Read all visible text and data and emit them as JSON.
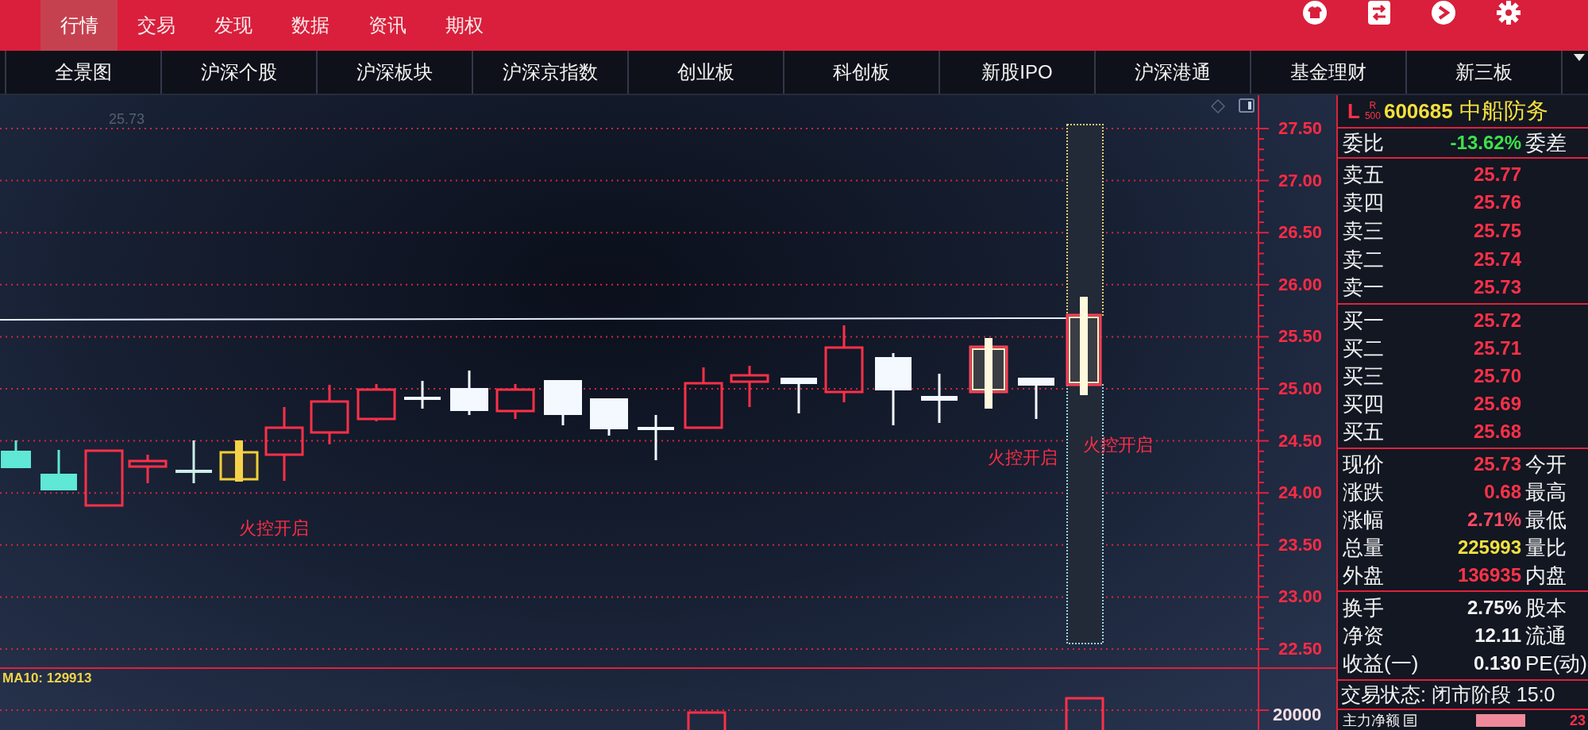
{
  "top_menu": [
    {
      "label": "行情",
      "selected": true
    },
    {
      "label": "交易",
      "selected": false
    },
    {
      "label": "发现",
      "selected": false
    },
    {
      "label": "数据",
      "selected": false
    },
    {
      "label": "资讯",
      "selected": false
    },
    {
      "label": "期权",
      "selected": false
    }
  ],
  "nav_tabs": [
    "全景图",
    "沪深个股",
    "沪深板块",
    "沪深京指数",
    "创业板",
    "科创板",
    "新股IPO",
    "沪深港通",
    "基金理财",
    "新三板"
  ],
  "chart": {
    "header_value": "25.73",
    "y_axis_labels": [
      "27.50",
      "27.00",
      "26.50",
      "26.00",
      "25.50",
      "25.00",
      "24.50",
      "24.00",
      "23.50",
      "23.00",
      "22.50"
    ],
    "annotations": [
      "火控开启",
      "火控开启",
      "火控开启"
    ],
    "indicator": "MA10: 129913",
    "volume_axis_label": "20000"
  },
  "quote_panel": {
    "market_tag": "L",
    "sub_tags": [
      "R",
      "500"
    ],
    "code": "600685",
    "name": "中船防务",
    "ratio": {
      "label": "委比",
      "value": "-13.62%",
      "right_label": "委差"
    },
    "asks": [
      {
        "label": "卖五",
        "price": "25.77"
      },
      {
        "label": "卖四",
        "price": "25.76"
      },
      {
        "label": "卖三",
        "price": "25.75"
      },
      {
        "label": "卖二",
        "price": "25.74"
      },
      {
        "label": "卖一",
        "price": "25.73"
      }
    ],
    "bids": [
      {
        "label": "买一",
        "price": "25.72"
      },
      {
        "label": "买二",
        "price": "25.71"
      },
      {
        "label": "买三",
        "price": "25.70"
      },
      {
        "label": "买四",
        "price": "25.69"
      },
      {
        "label": "买五",
        "price": "25.68"
      }
    ],
    "stats": [
      {
        "label": "现价",
        "value": "25.73",
        "right_label": "今开",
        "color": "#ff3348"
      },
      {
        "label": "涨跌",
        "value": "0.68",
        "right_label": "最高",
        "color": "#ff3348"
      },
      {
        "label": "涨幅",
        "value": "2.71%",
        "right_label": "最低",
        "color": "#ff4a60"
      },
      {
        "label": "总量",
        "value": "225993",
        "right_label": "量比",
        "color": "#f2e040"
      },
      {
        "label": "外盘",
        "value": "136935",
        "right_label": "内盘",
        "color": "#ff3348"
      }
    ],
    "fundamentals": [
      {
        "label": "换手",
        "value": "2.75%",
        "right_label": "股本"
      },
      {
        "label": "净资",
        "value": "12.11",
        "right_label": "流通"
      },
      {
        "label": "收益(一)",
        "value": "0.130",
        "right_label": "PE(动)"
      }
    ],
    "trade_status": "交易状态: 闭市阶段 15:0",
    "fund_flow": {
      "label": "主力净额",
      "value": "23"
    }
  }
}
